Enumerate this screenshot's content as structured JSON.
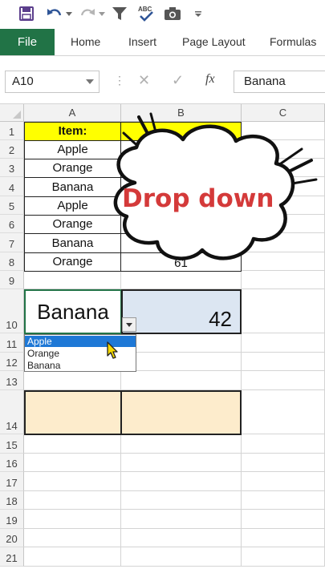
{
  "toolbar": {
    "icons": [
      "save-icon",
      "undo-icon",
      "redo-icon",
      "filter-icon",
      "spelling-icon",
      "camera-icon",
      "customize-icon"
    ]
  },
  "ribbon": {
    "tabs": [
      "File",
      "Home",
      "Insert",
      "Page Layout",
      "Formulas"
    ]
  },
  "formula_bar": {
    "name_box": "A10",
    "fx_label": "fx",
    "value": "Banana",
    "cancel_icon": "✕",
    "enter_icon": "✓"
  },
  "columns": [
    "A",
    "B",
    "C"
  ],
  "rows": [
    "1",
    "2",
    "3",
    "4",
    "5",
    "6",
    "7",
    "8",
    "9",
    "10",
    "11",
    "12",
    "13",
    "14",
    "15",
    "16",
    "17",
    "18",
    "19",
    "20",
    "21"
  ],
  "table": {
    "header_item": "Item:",
    "items": [
      "Apple",
      "Orange",
      "Banana",
      "Apple",
      "Orange",
      "Banana",
      "Orange"
    ],
    "last_qty": "61"
  },
  "lookup": {
    "selected": "Banana",
    "result": "42"
  },
  "dropdown": {
    "options": [
      "Apple",
      "Orange",
      "Banana"
    ],
    "highlighted_index": 0
  },
  "callout": {
    "text": "Drop down"
  },
  "colors": {
    "excel_green": "#217346",
    "header_yellow": "#ffff00",
    "result_blue": "#dce6f2",
    "peach": "#fdeccc",
    "callout_red": "#d43a3a",
    "dropdown_highlight": "#1e78d6"
  }
}
